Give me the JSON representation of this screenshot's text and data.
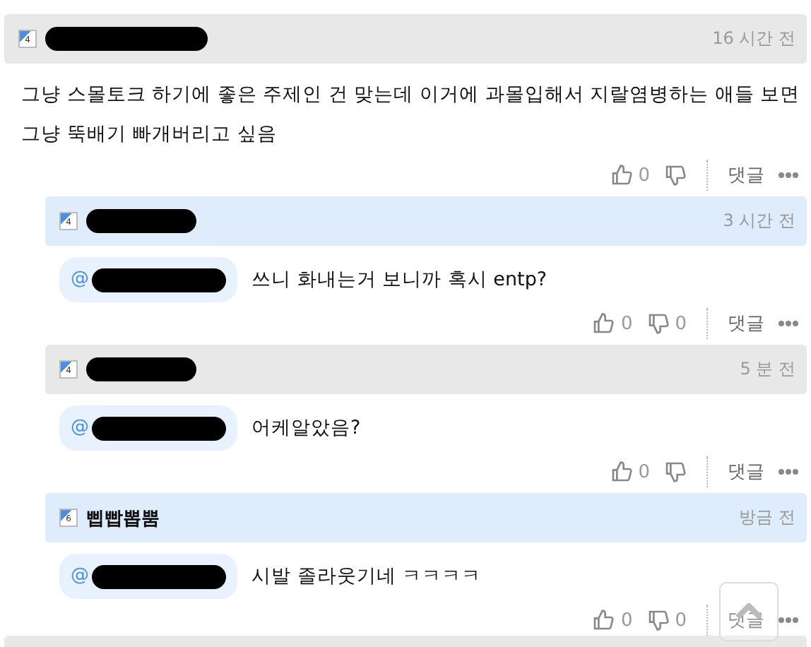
{
  "comments": [
    {
      "badge": "4",
      "highlighted": false,
      "time": "16 시간 전",
      "text": "그냥 스몰토크 하기에 좋은 주제인 건 맞는데 이거에 과몰입해서 지랄염병하는 애들 보면 그냥 뚝배기 빠개버리고 싶음",
      "likes": "0",
      "reply_label": "댓글",
      "replies": [
        {
          "badge": "4",
          "highlighted": true,
          "time": "3 시간 전",
          "mention_at": "@",
          "text": "쓰니 화내는거 보니까 혹시 entp?",
          "likes": "0",
          "dislikes": "0",
          "reply_label": "댓글"
        },
        {
          "badge": "4",
          "highlighted": false,
          "time": "5 분 전",
          "mention_at": "@",
          "text": "어케알았음?",
          "likes": "0",
          "reply_label": "댓글"
        },
        {
          "badge": "6",
          "highlighted": true,
          "author": "삡빱뽑뿜",
          "time": "방금 전",
          "mention_at": "@",
          "text": "시발 졸라웃기네 ㅋㅋㅋㅋ",
          "likes": "0",
          "dislikes": "0",
          "reply_label": "댓글"
        }
      ]
    }
  ]
}
